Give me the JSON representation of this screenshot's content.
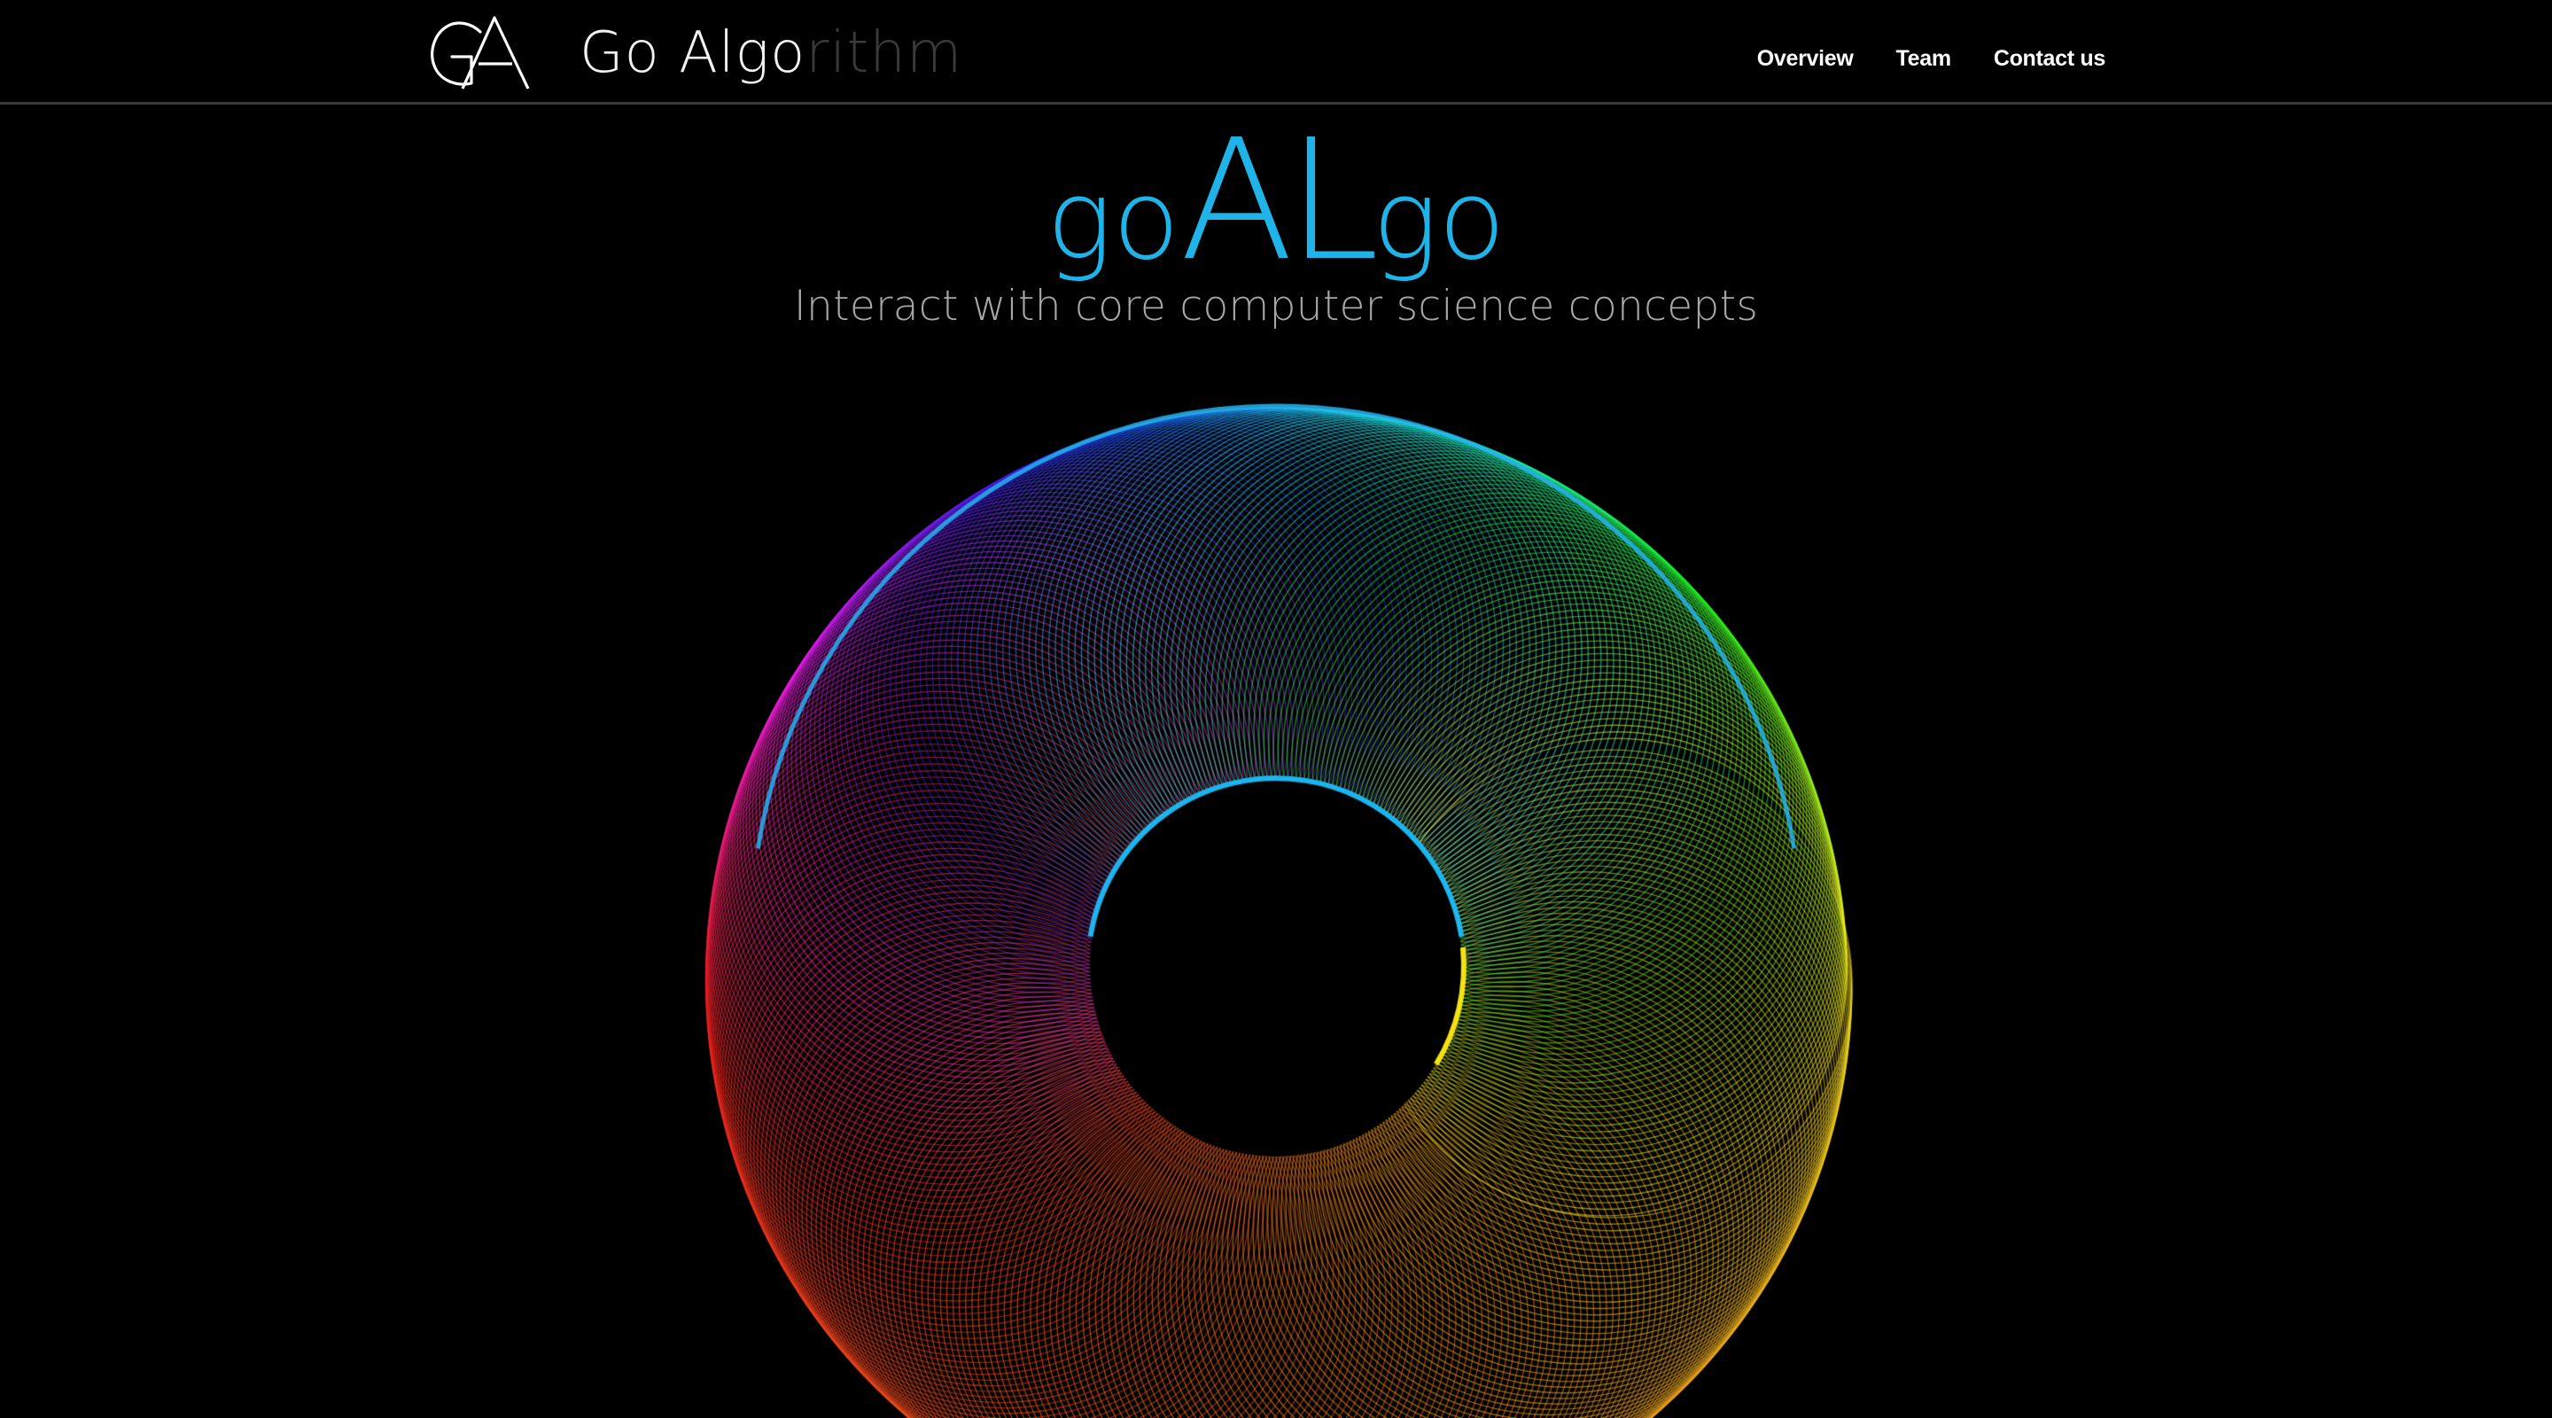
{
  "brand": {
    "name_part1": "Go Algo",
    "name_part2": "rithm",
    "logo_icon": "ga-monogram-icon"
  },
  "nav": {
    "items": [
      {
        "label": "Overview"
      },
      {
        "label": "Team"
      },
      {
        "label": "Contact us"
      }
    ]
  },
  "hero": {
    "title_part1": "go",
    "title_part2": "AL",
    "title_part3": "go",
    "subtitle": "Interact with core computer science concepts",
    "accent_color": "#1fb3e8",
    "graphic": "rainbow-spirograph-torus"
  },
  "colors": {
    "background": "#000000",
    "nav_text": "#ffffff",
    "brand_dim": "#3a3a3a",
    "subtitle": "#a8a8a8",
    "divider": "#3a3a3a"
  }
}
